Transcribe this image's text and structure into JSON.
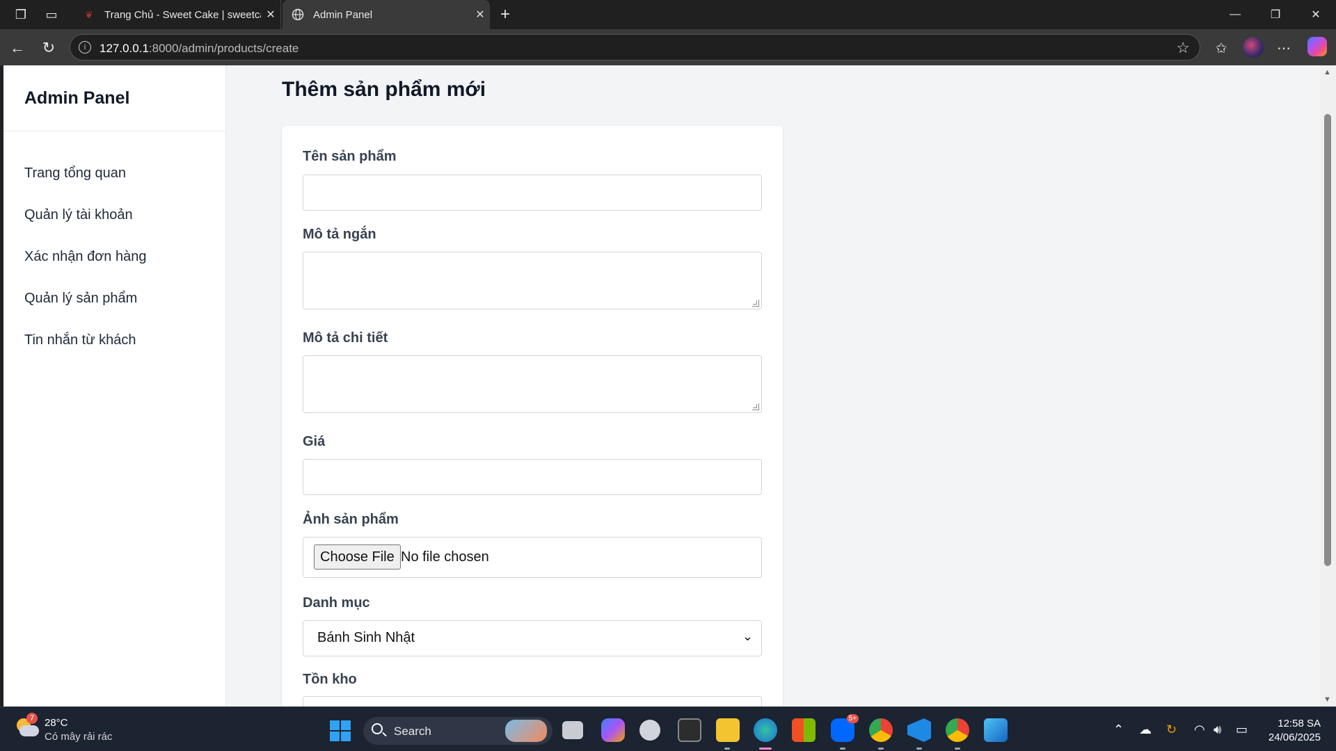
{
  "browser": {
    "tabs": [
      {
        "title": "Trang Chủ - Sweet Cake | sweetcake",
        "favicon": "cake-icon"
      },
      {
        "title": "Admin Panel",
        "favicon": "globe-icon"
      }
    ],
    "url_host": "127.0.0.1",
    "url_rest": ":8000/admin/products/create"
  },
  "sidebar": {
    "brand": "Admin Panel",
    "items": [
      {
        "label": "Trang tổng quan"
      },
      {
        "label": "Quản lý tài khoản"
      },
      {
        "label": "Xác nhận đơn hàng"
      },
      {
        "label": "Quản lý sản phẩm"
      },
      {
        "label": "Tin nhắn từ khách"
      }
    ]
  },
  "page": {
    "title": "Thêm sản phẩm mới",
    "form": {
      "name_label": "Tên sản phẩm",
      "name_value": "",
      "short_desc_label": "Mô tả ngắn",
      "short_desc_value": "",
      "detail_desc_label": "Mô tả chi tiết",
      "detail_desc_value": "",
      "price_label": "Giá",
      "price_value": "",
      "image_label": "Ảnh sản phẩm",
      "file_button": "Choose File",
      "file_status": "No file chosen",
      "category_label": "Danh mục",
      "category_selected": "Bánh Sinh Nhật",
      "stock_label": "Tồn kho"
    }
  },
  "taskbar": {
    "weather_temp": "28°C",
    "weather_desc": "Có mây rải rác",
    "weather_badge": "7",
    "search_label": "Search",
    "zalo_badge": "5+",
    "time": "12:58 SA",
    "date": "24/06/2025"
  },
  "colors": {
    "sidebar_bg": "#ffffff",
    "content_bg": "#f3f4f6",
    "taskbar_bg": "#1c2331",
    "browser_chrome": "#3a3a3a"
  }
}
